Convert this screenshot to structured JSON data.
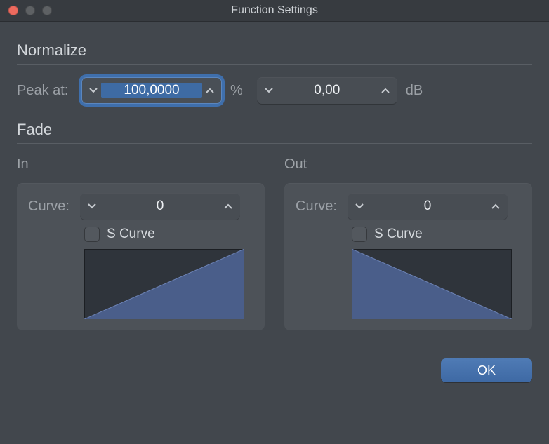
{
  "window": {
    "title": "Function Settings"
  },
  "normalize": {
    "section_title": "Normalize",
    "peak_label": "Peak at:",
    "peak_value": "100,0000",
    "peak_unit": "%",
    "db_value": "0,00",
    "db_unit": "dB"
  },
  "fade": {
    "section_title": "Fade",
    "in": {
      "subhead": "In",
      "curve_label": "Curve:",
      "curve_value": "0",
      "s_curve_label": "S Curve",
      "s_curve_checked": false,
      "shape": "fade-in"
    },
    "out": {
      "subhead": "Out",
      "curve_label": "Curve:",
      "curve_value": "0",
      "s_curve_label": "S Curve",
      "s_curve_checked": false,
      "shape": "fade-out"
    }
  },
  "buttons": {
    "ok": "OK"
  },
  "colors": {
    "accent": "#4a6fa0",
    "fade_fill": "#4a5e8a"
  }
}
